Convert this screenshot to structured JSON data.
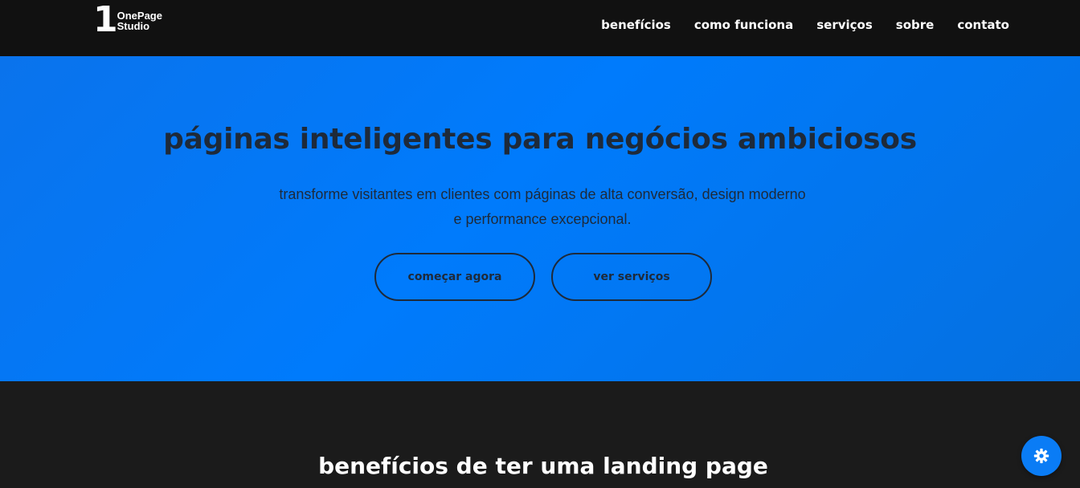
{
  "navbar": {
    "logo": {
      "mark": "1",
      "line1": "OnePage",
      "line2": "Studio"
    },
    "links": [
      {
        "label": "benefícios"
      },
      {
        "label": "como funciona"
      },
      {
        "label": "serviços"
      },
      {
        "label": "sobre"
      },
      {
        "label": "contato"
      }
    ]
  },
  "hero": {
    "title": "páginas inteligentes para negócios ambiciosos",
    "subtitle_line1": "transforme visitantes em clientes com páginas de alta conversão, design moderno",
    "subtitle_line2": "e performance excepcional.",
    "primary_button": "começar agora",
    "secondary_button": "ver serviços"
  },
  "benefits": {
    "title": "benefícios de ter uma landing page"
  },
  "fab": {
    "icon": "gear-icon"
  },
  "colors": {
    "navbar_bg": "#111111",
    "hero_bg": "#007bfc",
    "hero_text": "#1e2a3a",
    "section_bg": "#1b1b1b",
    "fab_bg": "#0a7cf5"
  }
}
